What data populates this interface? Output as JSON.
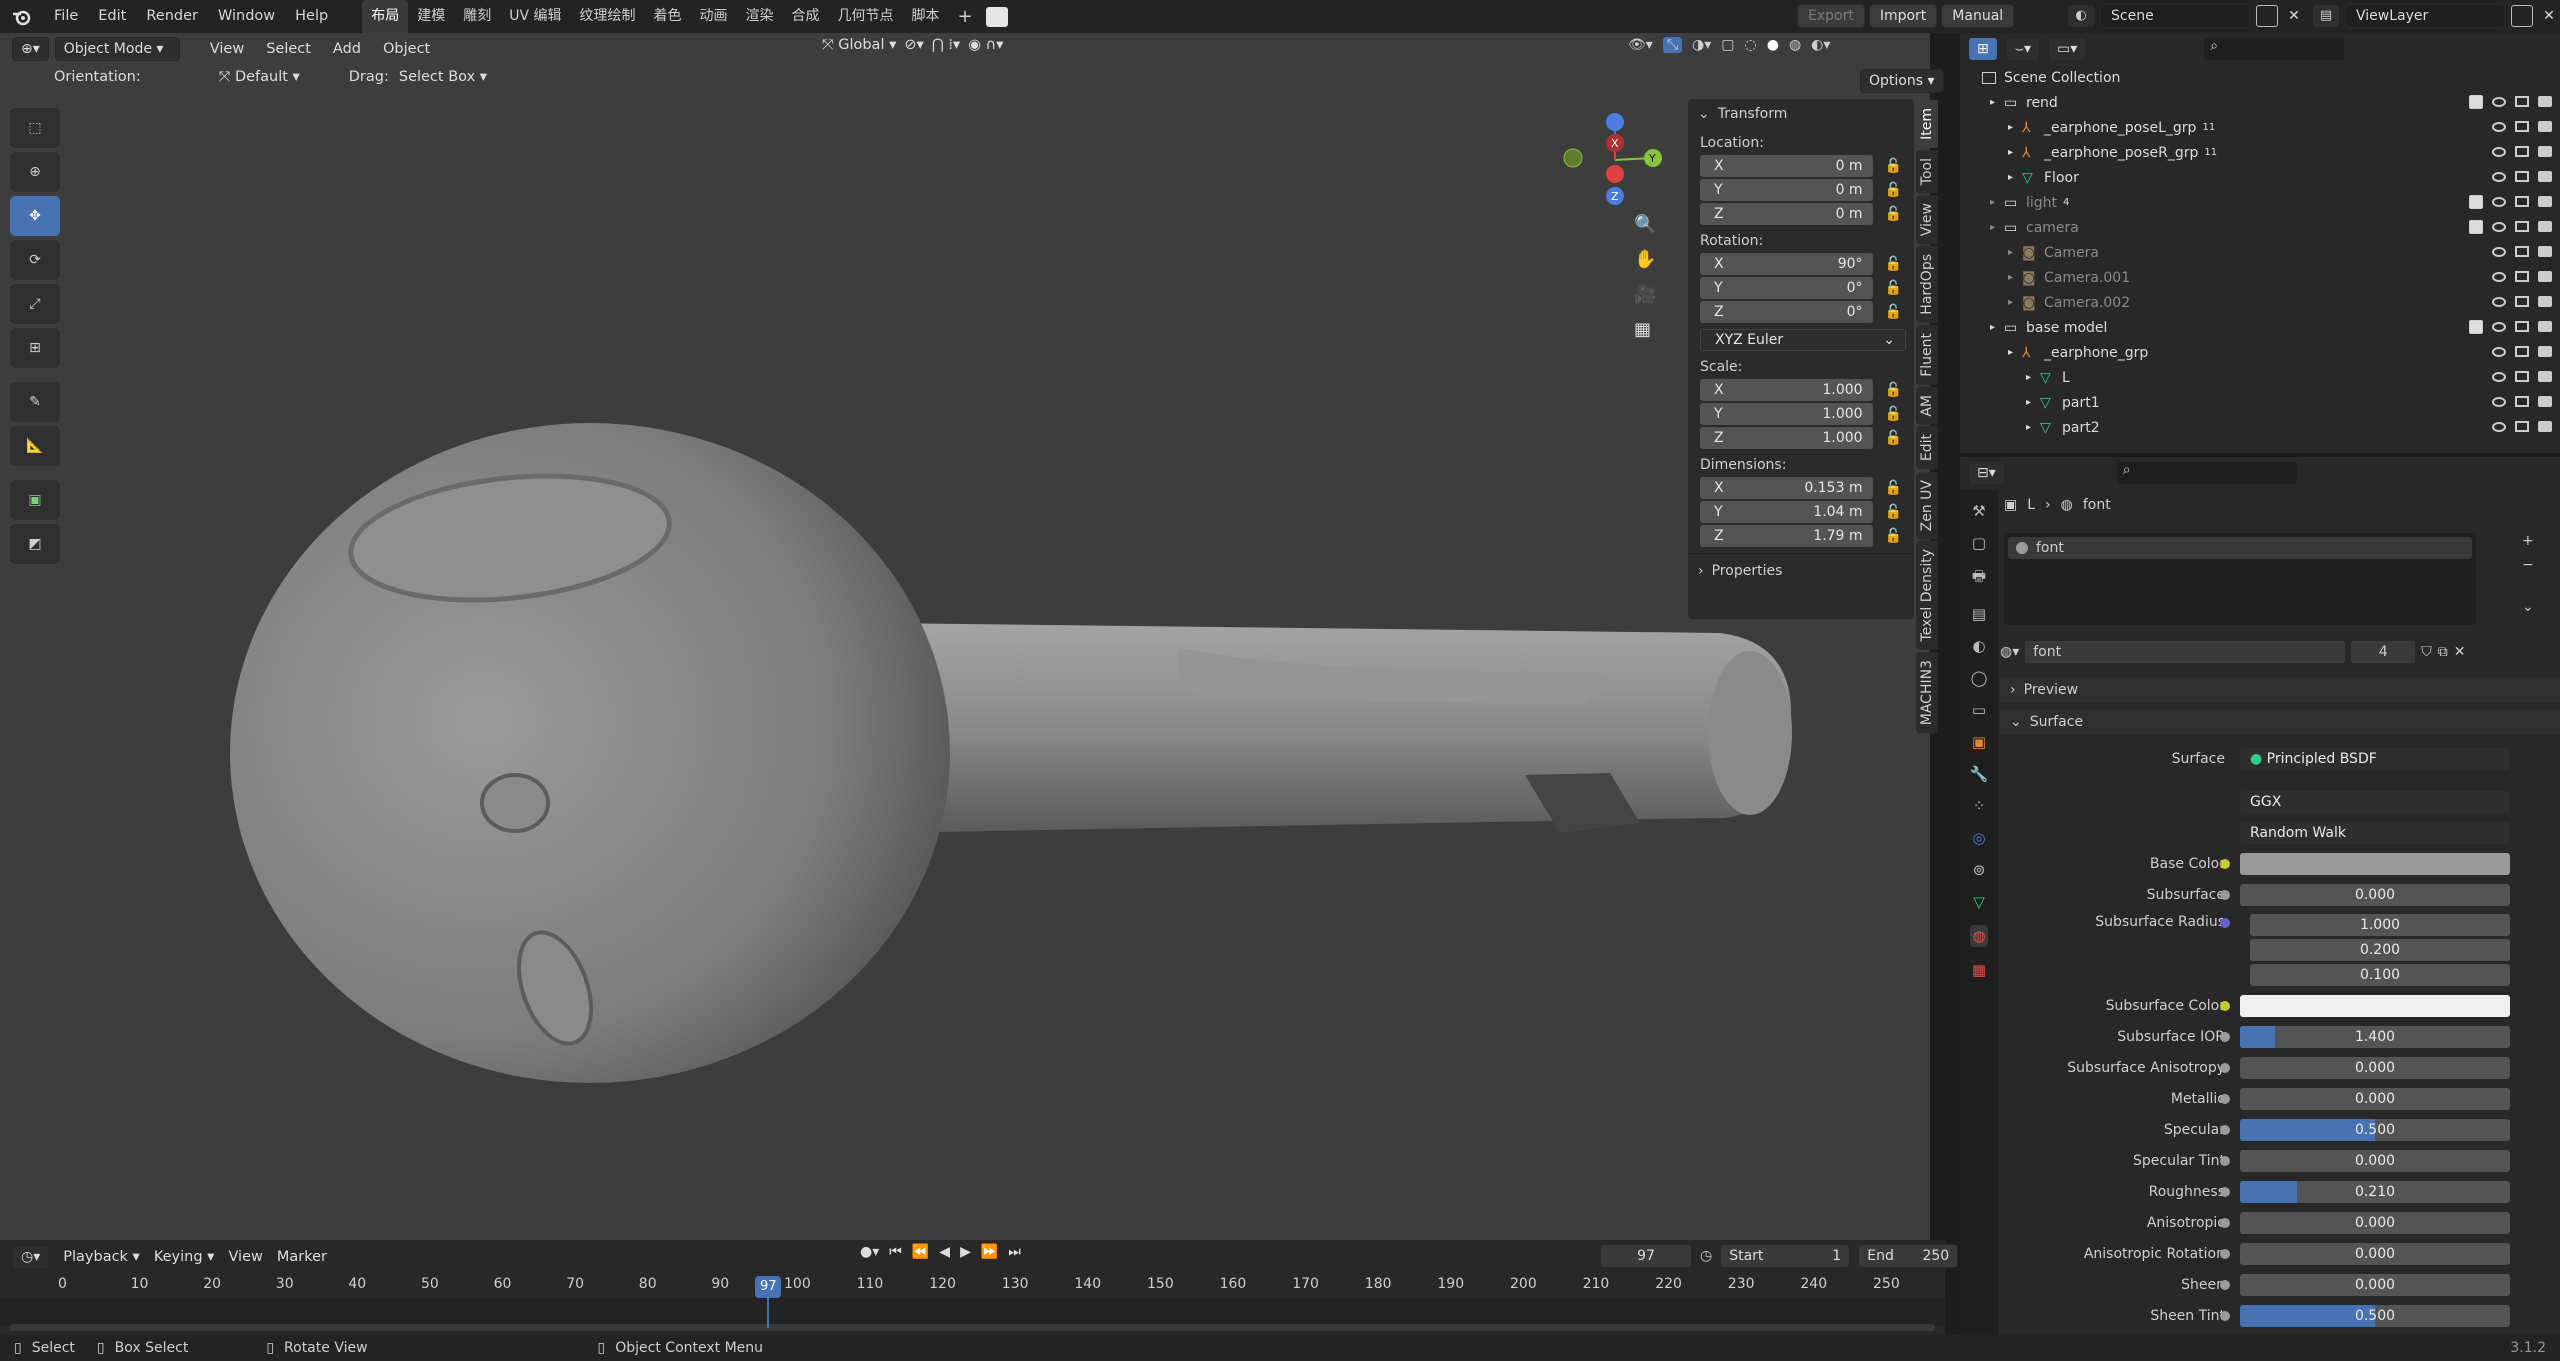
{
  "app": {
    "version": "3.1.2"
  },
  "topbar": {
    "menus": [
      "File",
      "Edit",
      "Render",
      "Window",
      "Help"
    ],
    "workspaces": [
      "布局",
      "建模",
      "雕刻",
      "UV 编辑",
      "纹理绘制",
      "着色",
      "动画",
      "渲染",
      "合成",
      "几何节点",
      "脚本"
    ],
    "active_workspace": "布局",
    "export_label": "Export",
    "import_label": "Import",
    "manual_label": "Manual",
    "scene": "Scene",
    "view_layer": "ViewLayer"
  },
  "viewport": {
    "mode": "Object Mode",
    "menus": [
      "View",
      "Select",
      "Add",
      "Object"
    ],
    "orientation_label": "Orientation:",
    "orientation_value": "Default",
    "drag_label": "Drag:",
    "drag_value": "Select Box",
    "transform_orientation": "Global",
    "options_label": "Options",
    "gizmo": {
      "x": "X",
      "y": "Y",
      "z": "Z"
    }
  },
  "npanel": {
    "tabs": [
      "Item",
      "Tool",
      "View",
      "HardOps",
      "Fluent",
      "AM",
      "Edit",
      "Zen UV",
      "Texel Density",
      "MACHIN3"
    ],
    "transform_title": "Transform",
    "location_label": "Location:",
    "location": [
      {
        "axis": "X",
        "value": "0 m"
      },
      {
        "axis": "Y",
        "value": "0 m"
      },
      {
        "axis": "Z",
        "value": "0 m"
      }
    ],
    "rotation_label": "Rotation:",
    "rotation": [
      {
        "axis": "X",
        "value": "90°"
      },
      {
        "axis": "Y",
        "value": "0°"
      },
      {
        "axis": "Z",
        "value": "0°"
      }
    ],
    "rotation_mode": "XYZ Euler",
    "scale_label": "Scale:",
    "scale": [
      {
        "axis": "X",
        "value": "1.000"
      },
      {
        "axis": "Y",
        "value": "1.000"
      },
      {
        "axis": "Z",
        "value": "1.000"
      }
    ],
    "dimensions_label": "Dimensions:",
    "dimensions": [
      {
        "axis": "X",
        "value": "0.153 m"
      },
      {
        "axis": "Y",
        "value": "1.04 m"
      },
      {
        "axis": "Z",
        "value": "1.79 m"
      }
    ],
    "properties_title": "Properties"
  },
  "outliner": {
    "root": "Scene Collection",
    "rows": [
      {
        "label": "rend",
        "indent": 1,
        "type": "collection",
        "dim": false
      },
      {
        "label": "_earphone_poseL_grp",
        "indent": 2,
        "type": "armature",
        "badge": "11",
        "dim": false
      },
      {
        "label": "_earphone_poseR_grp",
        "indent": 2,
        "type": "armature",
        "badge": "11",
        "dim": false
      },
      {
        "label": "Floor",
        "indent": 2,
        "type": "mesh",
        "dim": false
      },
      {
        "label": "light",
        "indent": 1,
        "type": "collection",
        "badge": "4",
        "dim": true
      },
      {
        "label": "camera",
        "indent": 1,
        "type": "collection",
        "dim": true
      },
      {
        "label": "Camera",
        "indent": 2,
        "type": "camera",
        "dim": true
      },
      {
        "label": "Camera.001",
        "indent": 2,
        "type": "camera",
        "dim": true
      },
      {
        "label": "Camera.002",
        "indent": 2,
        "type": "camera",
        "dim": true
      },
      {
        "label": "base model",
        "indent": 1,
        "type": "collection",
        "dim": false
      },
      {
        "label": "_earphone_grp",
        "indent": 2,
        "type": "armature",
        "dim": false
      },
      {
        "label": "L",
        "indent": 3,
        "type": "mesh",
        "dim": false
      },
      {
        "label": "part1",
        "indent": 3,
        "type": "mesh",
        "dim": false
      },
      {
        "label": "part2",
        "indent": 3,
        "type": "mesh",
        "dim": false
      }
    ]
  },
  "properties": {
    "breadcrumb_object": "L",
    "breadcrumb_material": "font",
    "slot_name": "font",
    "material_name": "font",
    "material_users": "4",
    "preview_label": "Preview",
    "surface_panel": "Surface",
    "surface_label": "Surface",
    "surface_shader": "Principled BSDF",
    "distribution": "GGX",
    "subsurface_method": "Random Walk",
    "fields": [
      {
        "label": "Base Color",
        "type": "color",
        "value": "",
        "color": "#9a9a9a",
        "dot": "#c8c832"
      },
      {
        "label": "Subsurface",
        "type": "num",
        "value": "0.000",
        "fill": 0
      },
      {
        "label": "Subsurface Radius",
        "type": "vec",
        "values": [
          "1.000",
          "0.200",
          "0.100"
        ],
        "dot": "#6363c7"
      },
      {
        "label": "Subsurface Color",
        "type": "color",
        "value": "",
        "color": "#f0f0f0",
        "dot": "#c8c832"
      },
      {
        "label": "Subsurface IOR",
        "type": "num",
        "value": "1.400",
        "fill": 0.13
      },
      {
        "label": "Subsurface Anisotropy",
        "type": "num",
        "value": "0.000",
        "fill": 0
      },
      {
        "label": "Metallic",
        "type": "num",
        "value": "0.000",
        "fill": 0
      },
      {
        "label": "Specular",
        "type": "num",
        "value": "0.500",
        "fill": 0.5
      },
      {
        "label": "Specular Tint",
        "type": "num",
        "value": "0.000",
        "fill": 0
      },
      {
        "label": "Roughness",
        "type": "num",
        "value": "0.210",
        "fill": 0.21
      },
      {
        "label": "Anisotropic",
        "type": "num",
        "value": "0.000",
        "fill": 0
      },
      {
        "label": "Anisotropic Rotation",
        "type": "num",
        "value": "0.000",
        "fill": 0
      },
      {
        "label": "Sheen",
        "type": "num",
        "value": "0.000",
        "fill": 0
      },
      {
        "label": "Sheen Tint",
        "type": "num",
        "value": "0.500",
        "fill": 0.5
      }
    ]
  },
  "timeline": {
    "menus": [
      "Playback",
      "Keying",
      "View",
      "Marker"
    ],
    "current_frame": "97",
    "start_label": "Start",
    "start": "1",
    "end_label": "End",
    "end": "250",
    "ticks": [
      "0",
      "10",
      "20",
      "30",
      "40",
      "50",
      "60",
      "70",
      "80",
      "90",
      "100",
      "110",
      "120",
      "130",
      "140",
      "150",
      "160",
      "170",
      "180",
      "190",
      "200",
      "210",
      "220",
      "230",
      "240",
      "250"
    ]
  },
  "statusbar": {
    "select": "Select",
    "box_select": "Box Select",
    "rotate_view": "Rotate View",
    "context_menu": "Object Context Menu",
    "version": "3.1.2"
  },
  "colors": {
    "accent": "#4772b3",
    "selected_object": "#e0883a",
    "mesh_icon": "#2fcf8a"
  }
}
